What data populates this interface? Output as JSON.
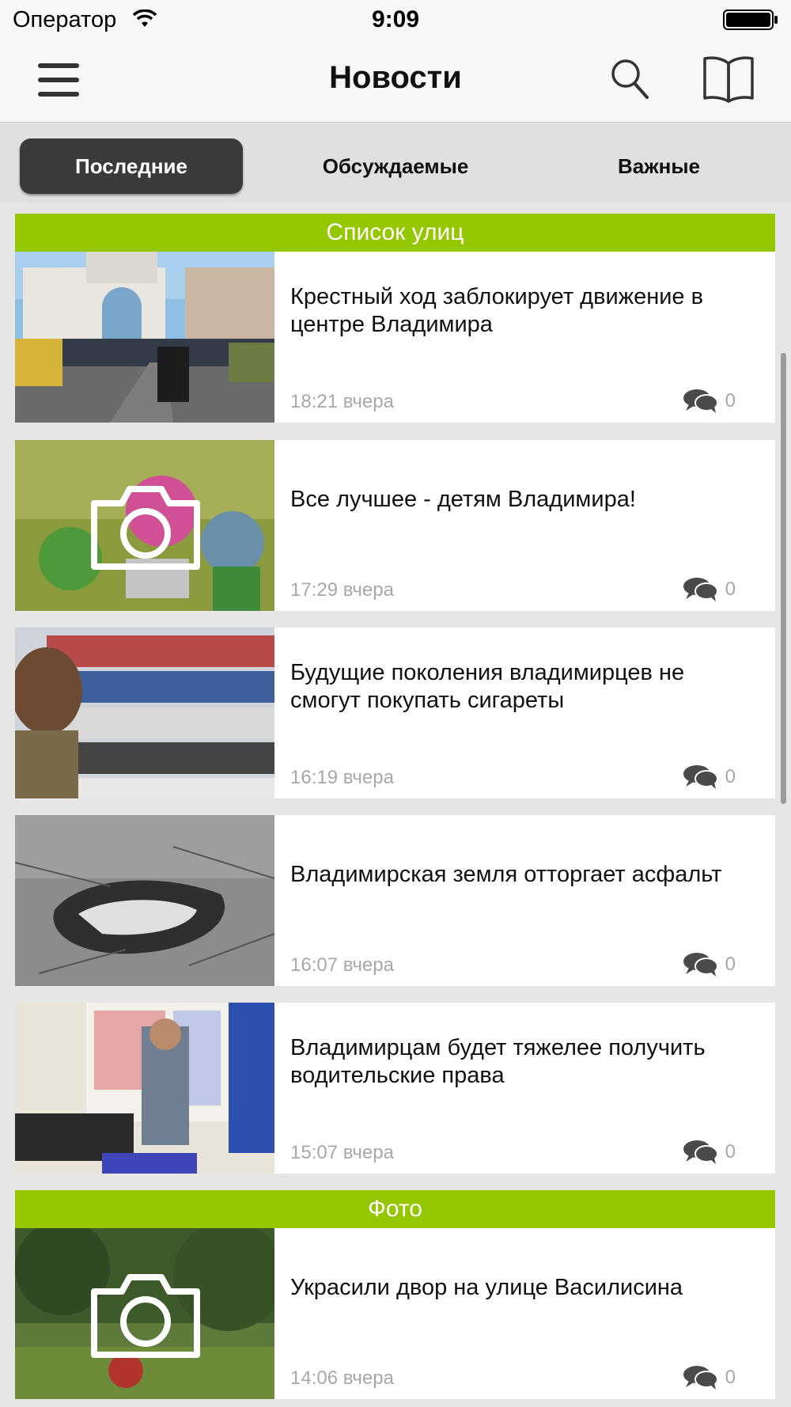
{
  "status_bar": {
    "carrier": "Оператор",
    "time": "9:09"
  },
  "nav": {
    "title": "Новости",
    "menu_icon": "hamburger-menu-icon",
    "search_icon": "search-icon",
    "bookmarks_icon": "book-icon"
  },
  "tabs": [
    {
      "label": "Последние",
      "active": true
    },
    {
      "label": "Обсуждаемые",
      "active": false
    },
    {
      "label": "Важные",
      "active": false
    }
  ],
  "sections": [
    {
      "title": "Список улиц"
    },
    {
      "title": "Фото"
    }
  ],
  "news": [
    {
      "title": "Крестный ход заблокирует движение в центре Владимира",
      "time": "18:21 вчера",
      "comments": "0",
      "photo_badge": false
    },
    {
      "title": "Все лучшее - детям Владимира!",
      "time": "17:29 вчера",
      "comments": "0",
      "photo_badge": true
    },
    {
      "title": "Будущие поколения владимирцев не смогут покупать сигареты",
      "time": "16:19 вчера",
      "comments": "0",
      "photo_badge": false
    },
    {
      "title": "Владимирская земля отторгает асфальт",
      "time": "16:07 вчера",
      "comments": "0",
      "photo_badge": false
    },
    {
      "title": "Владимирцам будет тяжелее получить водительские права",
      "time": "15:07 вчера",
      "comments": "0",
      "photo_badge": false
    },
    {
      "title": "Украсили двор на улице Василисина",
      "time": "14:06 вчера",
      "comments": "0",
      "photo_badge": true
    }
  ],
  "colors": {
    "section_header": "#94c700",
    "active_tab": "#3a3a3a",
    "background": "#e6e6e6"
  }
}
